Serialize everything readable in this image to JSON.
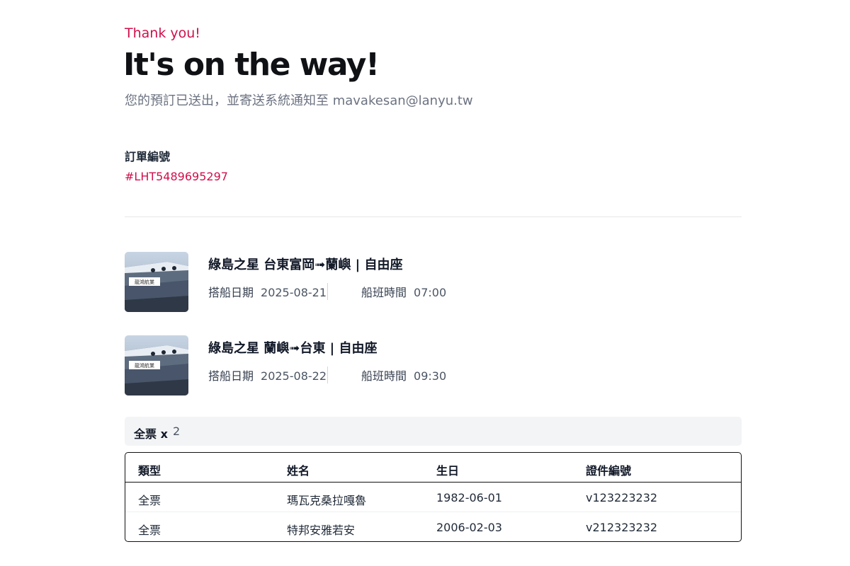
{
  "header": {
    "eyebrow": "Thank you!",
    "title": "It's on the way!",
    "subtitle": "您的預訂已送出，並寄送系統通知至 mavakesan@lanyu.tw"
  },
  "order": {
    "label": "訂單編號",
    "number": "#LHT5489695297"
  },
  "trips": [
    {
      "thumb_label": "龍鴻航業",
      "title": "綠島之星 台東富岡➟蘭嶼 | 自由座",
      "date_label": "搭船日期",
      "date": "2025-08-21",
      "time_label": "船班時間",
      "time": "07:00"
    },
    {
      "thumb_label": "龍鴻航業",
      "title": "綠島之星 蘭嶼➟台東 | 自由座",
      "date_label": "搭船日期",
      "date": "2025-08-22",
      "time_label": "船班時間",
      "time": "09:30"
    }
  ],
  "ticket_summary": {
    "label": "全票 x",
    "count": "2"
  },
  "passengers": {
    "columns": [
      "類型",
      "姓名",
      "生日",
      "證件編號"
    ],
    "rows": [
      [
        "全票",
        "瑪瓦克桑拉嘎魯",
        "1982-06-01",
        "v123223232"
      ],
      [
        "全票",
        "特邦安雅若安",
        "2006-02-03",
        "v212323232"
      ]
    ]
  },
  "colors": {
    "accent": "#d0104c",
    "muted_text": "#6b7280",
    "summary_bg": "#f3f4f6"
  }
}
